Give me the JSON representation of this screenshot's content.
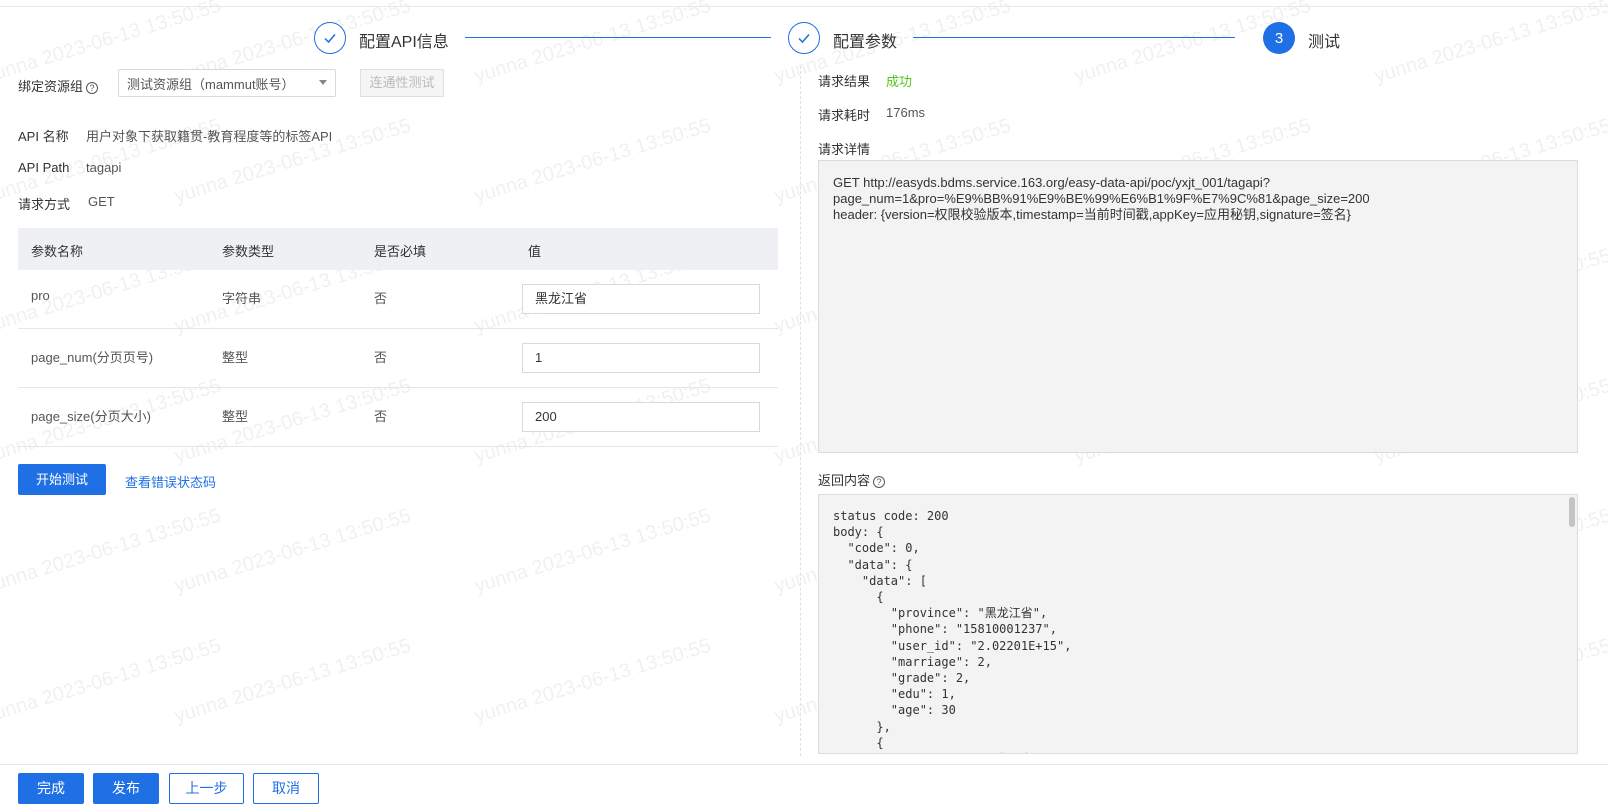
{
  "steps": [
    {
      "label": "配置API信息",
      "status": "done"
    },
    {
      "label": "配置参数",
      "status": "done"
    },
    {
      "label": "测试",
      "status": "active",
      "number": "3"
    }
  ],
  "resource_group": {
    "label": "绑定资源组",
    "help": "?",
    "selected": "测试资源组（mammut账号）",
    "test_button": "连通性测试"
  },
  "api_info": {
    "name_label": "API 名称",
    "name_value": "用户对象下获取籍贯-教育程度等的标签API",
    "path_label": "API Path",
    "path_value": "tagapi",
    "method_label": "请求方式",
    "method_value": "GET"
  },
  "table": {
    "headers": [
      "参数名称",
      "参数类型",
      "是否必填",
      "值"
    ],
    "rows": [
      {
        "name": "pro",
        "type": "字符串",
        "required": "否",
        "value": "黑龙江省"
      },
      {
        "name": "page_num(分页页号)",
        "type": "整型",
        "required": "否",
        "value": "1"
      },
      {
        "name": "page_size(分页大小)",
        "type": "整型",
        "required": "否",
        "value": "200"
      }
    ]
  },
  "actions": {
    "start_test": "开始测试",
    "view_error_codes": "查看错误状态码"
  },
  "result": {
    "result_label": "请求结果",
    "result_value": "成功",
    "time_label": "请求耗时",
    "time_value": "176ms",
    "detail_label": "请求详情",
    "detail_lines": [
      "GET http://easyds.bdms.service.163.org/easy-data-api/poc/yxjt_001/tagapi?",
      "page_num=1&pro=%E9%BB%91%E9%BE%99%E6%B1%9F%E7%9C%81&page_size=200",
      "header: {version=权限校验版本,timestamp=当前时间戳,appKey=应用秘钥,signature=签名}"
    ],
    "response_label": "返回内容",
    "response_help": "?",
    "response_text": "status code: 200\nbody: {\n  \"code\": 0,\n  \"data\": {\n    \"data\": [\n      {\n        \"province\": \"黑龙江省\",\n        \"phone\": \"15810001237\",\n        \"user_id\": \"2.02201E+15\",\n        \"marriage\": 2,\n        \"grade\": 2,\n        \"edu\": 1,\n        \"age\": 30\n      },\n      {\n        \"province\": \"黑龙江省\","
  },
  "footer": {
    "done": "完成",
    "publish": "发布",
    "prev": "上一步",
    "cancel": "取消"
  },
  "watermark": "yunna 2023-06-13 13:50:55",
  "colors": {
    "primary": "#1f6fe5",
    "success": "#52c41a"
  }
}
